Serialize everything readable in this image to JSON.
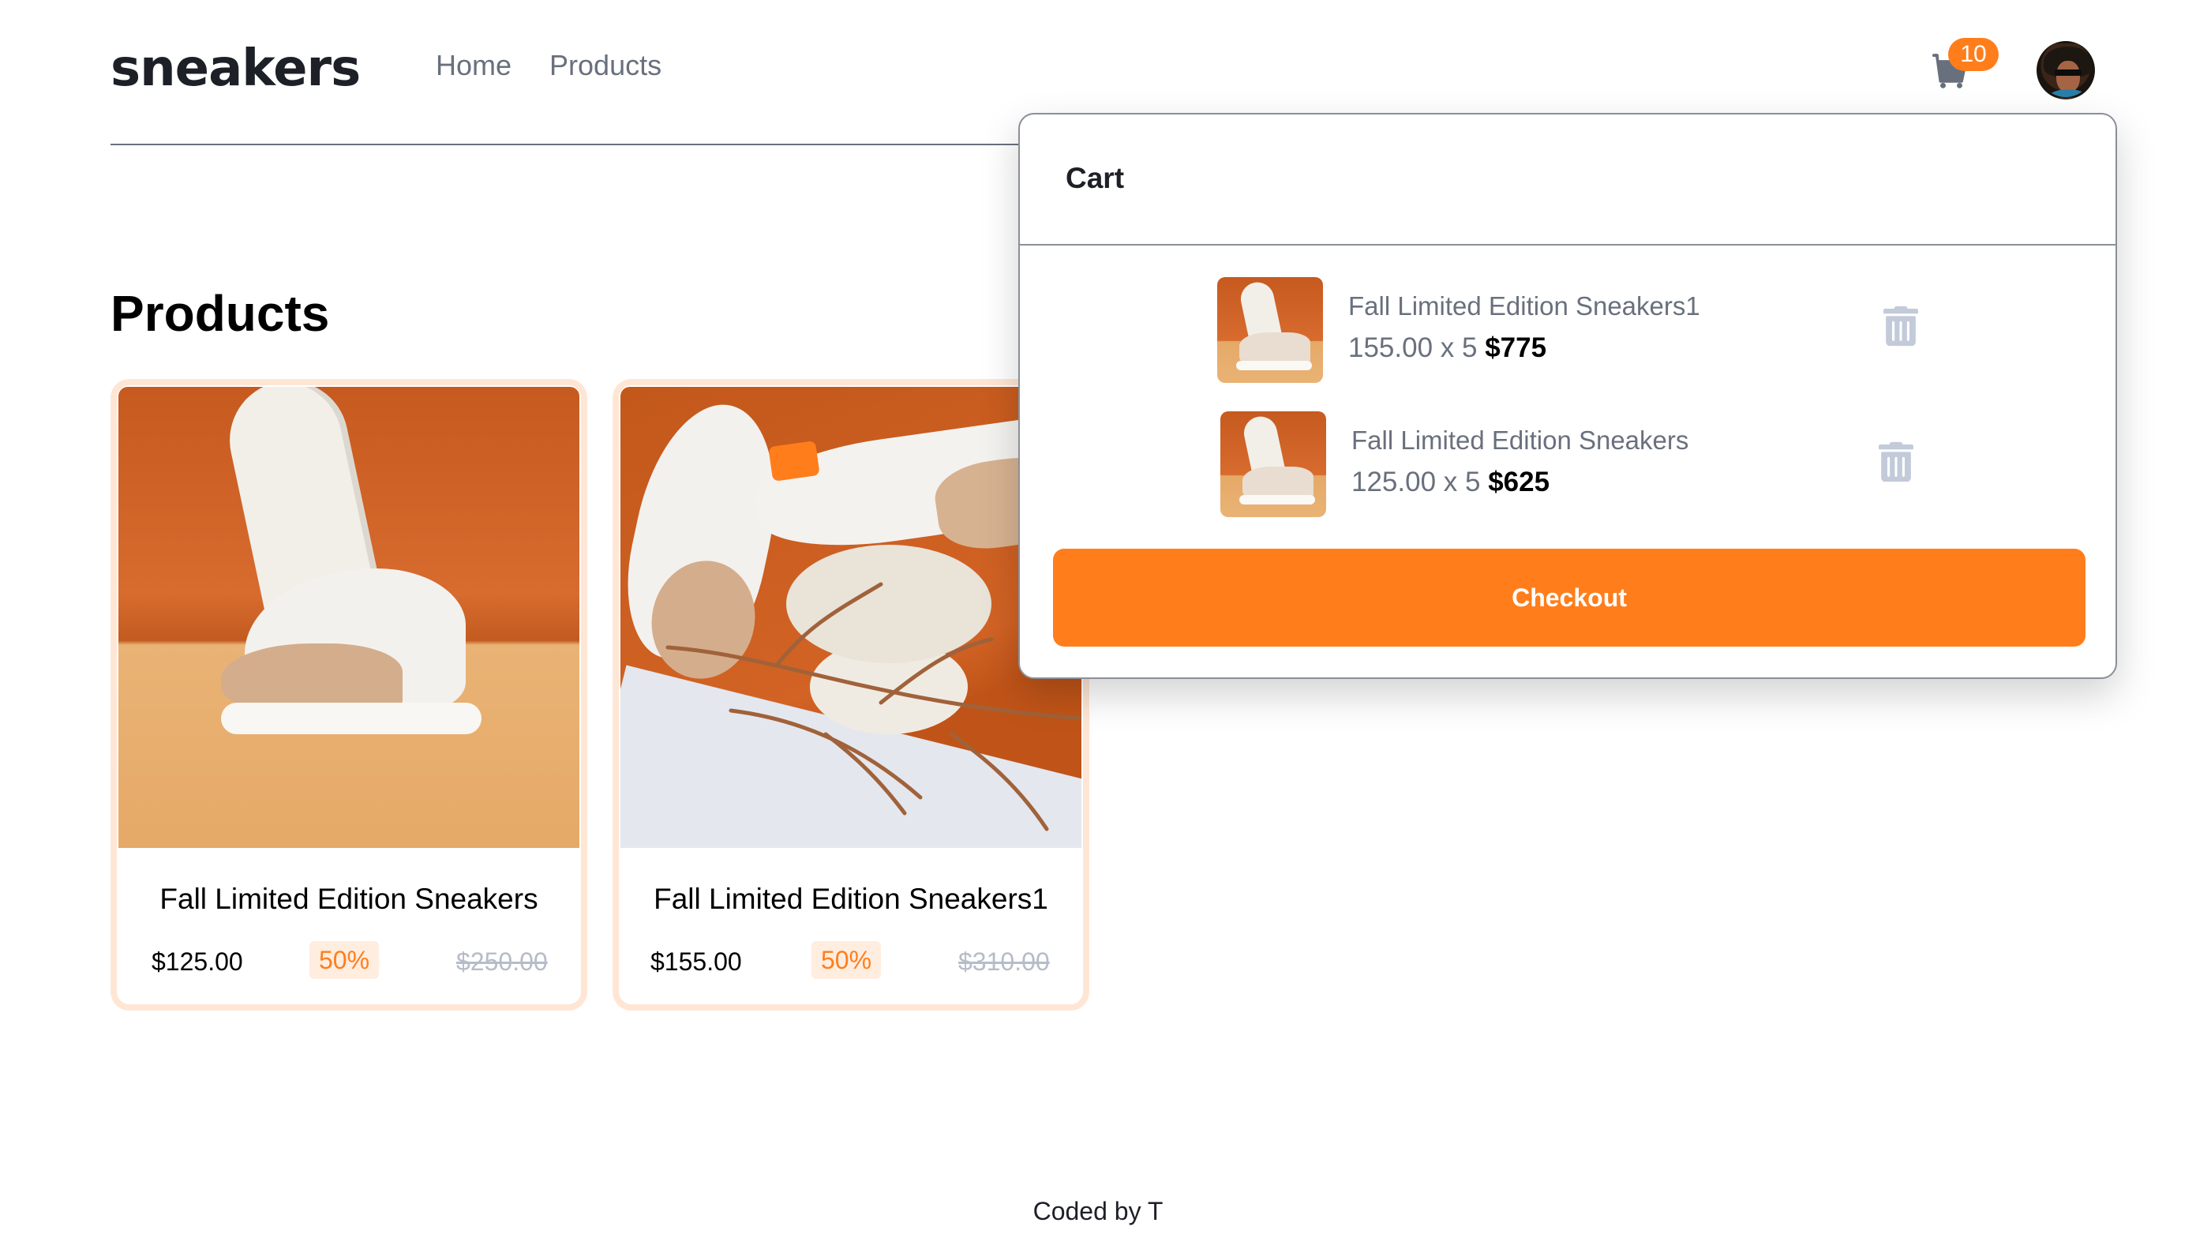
{
  "header": {
    "logo": "sneakers",
    "nav": [
      {
        "label": "Home"
      },
      {
        "label": "Products"
      }
    ],
    "cart_count": "10"
  },
  "products_section": {
    "title": "Products",
    "items": [
      {
        "name": "Fall Limited Edition Sneakers",
        "price": "$125.00",
        "discount": "50%",
        "original_price": "$250.00"
      },
      {
        "name": "Fall Limited Edition Sneakers1",
        "price": "$155.00",
        "discount": "50%",
        "original_price": "$310.00"
      }
    ]
  },
  "cart": {
    "title": "Cart",
    "items": [
      {
        "name": "Fall Limited Edition Sneakers1",
        "qty_text": "155.00 x 5",
        "total": "$775"
      },
      {
        "name": "Fall Limited Edition Sneakers",
        "qty_text": "125.00 x 5",
        "total": "$625"
      }
    ],
    "checkout_label": "Checkout"
  },
  "footer": {
    "text": "Coded by T"
  },
  "colors": {
    "accent": "#ff7e1b",
    "accent_pale": "#ffede0",
    "text_dark": "#1d2026",
    "text_grey": "#69707d"
  }
}
